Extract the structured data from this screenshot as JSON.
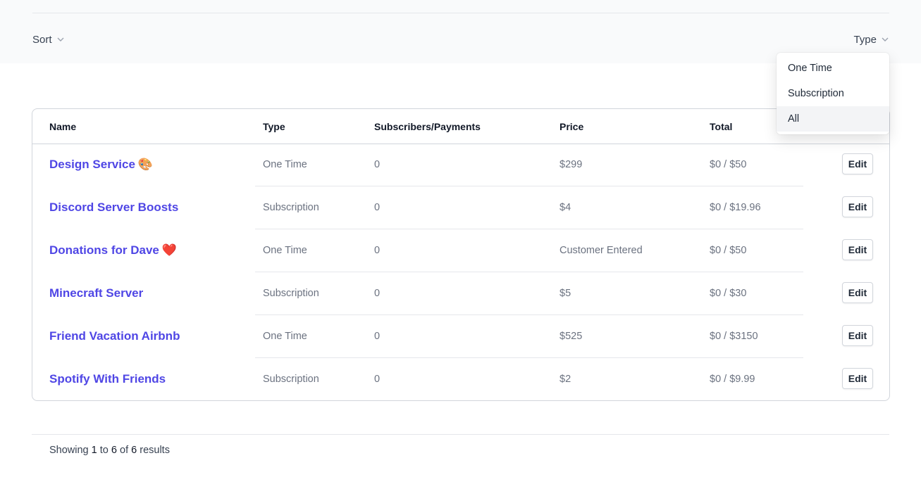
{
  "filters": {
    "sort_label": "Sort",
    "type_label": "Type",
    "type_options": [
      {
        "label": "One Time",
        "selected": false
      },
      {
        "label": "Subscription",
        "selected": false
      },
      {
        "label": "All",
        "selected": true
      }
    ]
  },
  "table": {
    "columns": [
      "Name",
      "Type",
      "Subscribers/Payments",
      "Price",
      "Total"
    ],
    "edit_label": "Edit",
    "rows": [
      {
        "name": "Design Service",
        "emoji": "🎨",
        "type": "One Time",
        "subs": "0",
        "price": "$299",
        "total": "$0 / $50"
      },
      {
        "name": "Discord Server Boosts",
        "emoji": "",
        "type": "Subscription",
        "subs": "0",
        "price": "$4",
        "total": "$0 / $19.96"
      },
      {
        "name": "Donations for Dave",
        "emoji": "❤️",
        "type": "One Time",
        "subs": "0",
        "price": "Customer Entered",
        "total": "$0 / $50"
      },
      {
        "name": "Minecraft Server",
        "emoji": "",
        "type": "Subscription",
        "subs": "0",
        "price": "$5",
        "total": "$0 / $30"
      },
      {
        "name": "Friend Vacation Airbnb",
        "emoji": "",
        "type": "One Time",
        "subs": "0",
        "price": "$525",
        "total": "$0 / $3150"
      },
      {
        "name": "Spotify With Friends",
        "emoji": "",
        "type": "Subscription",
        "subs": "0",
        "price": "$2",
        "total": "$0 / $9.99"
      }
    ]
  },
  "pagination": {
    "prefix": "Showing",
    "from": "1",
    "to_word": "to",
    "to": "6",
    "of_word": "of",
    "total": "6",
    "suffix": "results"
  },
  "colors": {
    "accent": "#4f46e5",
    "filter_bar_bg": "#f9fafb",
    "border": "#d1d5db"
  }
}
